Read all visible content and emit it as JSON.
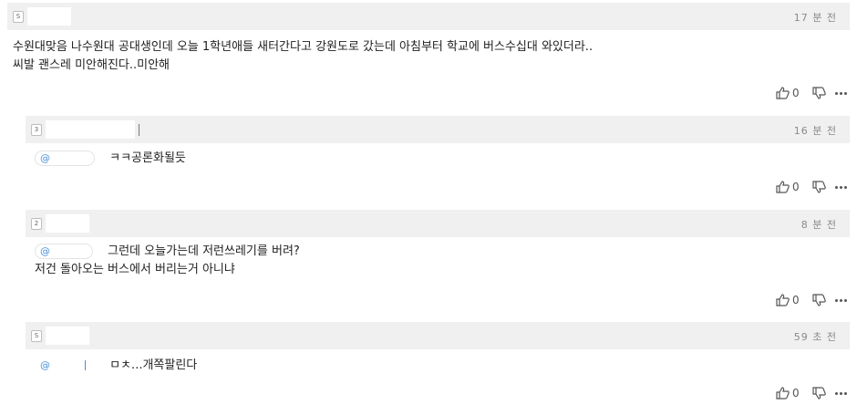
{
  "comments": [
    {
      "badge": "S",
      "time": "17 분 전",
      "lines": [
        "수원대맞음 나수원대 공대생인데 오늘 1학년애들 새터간다고 강원도로 갔는데 아침부터 학교에 버스수십대 와있더라..",
        "씨발 괜스레 미안해진다..미안해"
      ],
      "likes": "0"
    },
    {
      "badge": "3",
      "time": "16 분 전",
      "mention": "@",
      "lines": [
        "ㅋㅋ공론화될듯"
      ],
      "likes": "0"
    },
    {
      "badge": "2",
      "time": "8 분 전",
      "mention": "@",
      "lines": [
        "그런데 오늘가는데 저런쓰레기를 버려?",
        "저건 돌아오는 버스에서 버리는거 아니냐"
      ],
      "likes": "0"
    },
    {
      "badge": "S",
      "time": "59 초 전",
      "mention": "@",
      "lines": [
        "ㅁㅊ...개쪽팔린다"
      ],
      "likes": "0"
    }
  ],
  "icons": {
    "like": "thumbs-up-icon",
    "dislike": "thumbs-down-icon",
    "more": "more-icon"
  }
}
